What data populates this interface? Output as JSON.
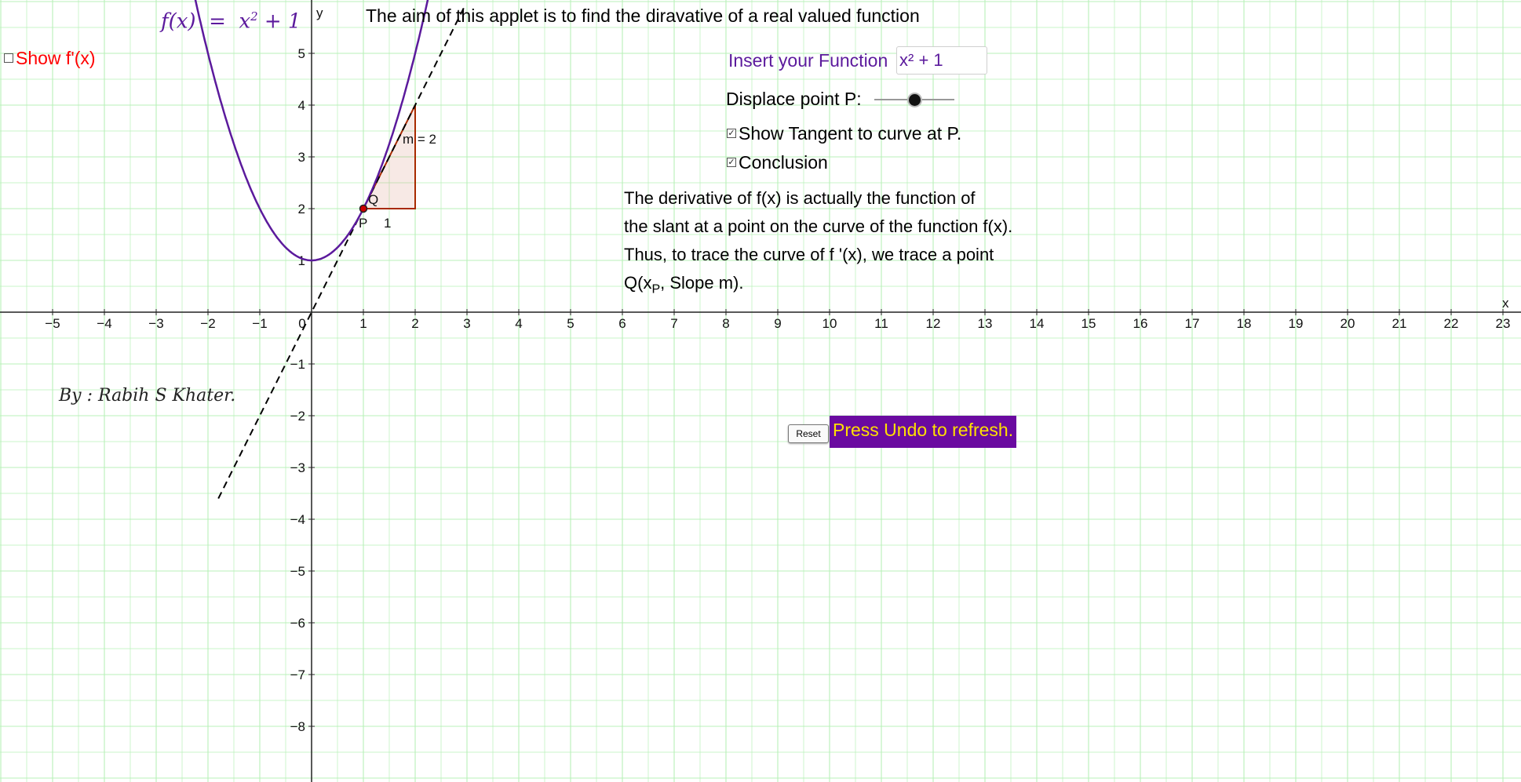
{
  "header": {
    "aim_text": "The aim of this applet is to find the diravative of a real valued function",
    "function_label": {
      "lhs": "f(x)",
      "eq": "=",
      "rhs": "x",
      "sup": "2",
      "tail": " + 1"
    },
    "author": "By : Rabih S Khater."
  },
  "controls": {
    "show_fprime": {
      "label": "Show f'(x)",
      "checked": false
    },
    "insert_function": {
      "label": "Insert your Function",
      "value": "x² + 1"
    },
    "displace_point": {
      "label": "Displace point P:",
      "slider_value": 0.5
    },
    "show_tangent": {
      "label": "Show Tangent to curve at P.",
      "checked": true
    },
    "conclusion": {
      "label": "Conclusion",
      "checked": true
    },
    "reset_button": "Reset",
    "undo_hint": "Press Undo to refresh."
  },
  "conclusion_text": {
    "line1": "The derivative of f(x)  is actually the function of",
    "line2": "the slant at a point on the curve of the function f(x).",
    "line3": "Thus, to trace the curve of f '(x), we trace a point",
    "line4_pre": "Q(x",
    "line4_sub": "P",
    "line4_post": ", Slope m)."
  },
  "graph_labels": {
    "x_axis": "x",
    "y_axis": "y",
    "point_p": "P",
    "point_q": "Q",
    "slope_label": "m = 2",
    "run_label": "1"
  },
  "chart_data": {
    "type": "line",
    "function": "f(x) = x^2 + 1",
    "xlim": [
      -6,
      23.5
    ],
    "ylim": [
      -9,
      6
    ],
    "x_ticks": [
      -5,
      -4,
      -3,
      -2,
      -1,
      0,
      1,
      2,
      3,
      4,
      5,
      6,
      7,
      8,
      9,
      10,
      11,
      12,
      13,
      14,
      15,
      16,
      17,
      18,
      19,
      20,
      21,
      22,
      23
    ],
    "y_ticks": [
      -8,
      -7,
      -6,
      -5,
      -4,
      -3,
      -2,
      -1,
      1,
      2,
      3,
      4,
      5
    ],
    "grid": true,
    "point_P": {
      "x": 1,
      "y": 2
    },
    "point_Q": {
      "x": 1,
      "y": 2
    },
    "tangent": {
      "slope": 2,
      "intercept": 0
    },
    "slope_triangle": {
      "run": 1,
      "rise": 2
    },
    "colors": {
      "curve": "#5b1a9c",
      "tangent": "#000000",
      "grid": "#b8f0b8",
      "triangle": "#a82a00",
      "point_q": "#e00000",
      "fprime_label": "#ff0000",
      "undo_bg": "#6a0aa0",
      "undo_text": "#ffe000"
    }
  }
}
